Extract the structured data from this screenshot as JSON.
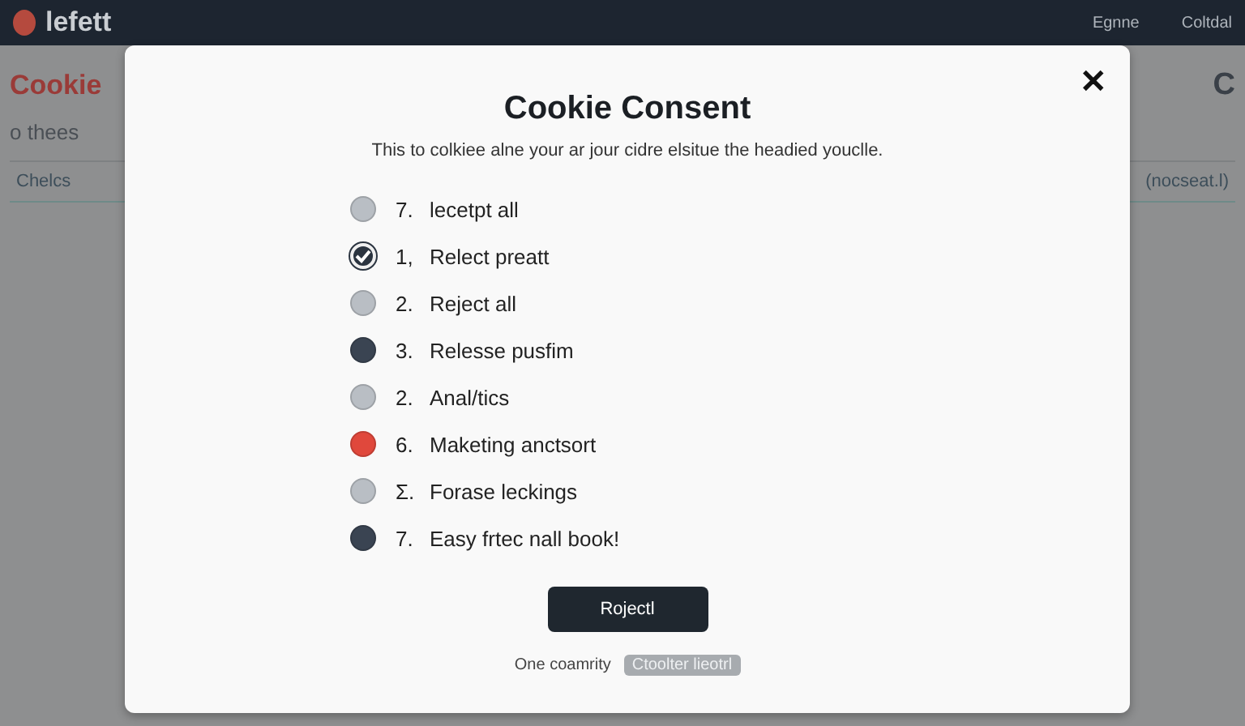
{
  "topbar": {
    "logo": "lefett",
    "links": [
      "Egnne",
      "Coltdal"
    ]
  },
  "background": {
    "heading": "Cookie",
    "intro": "o thees",
    "tab": "Chelcs",
    "tab_right": "(nocseat.l)",
    "right_icon": "C"
  },
  "modal": {
    "title": "Cookie Consent",
    "subtitle": "This to colkiee alne your ar jour cidre elsitue the headied youclle.",
    "options": [
      {
        "number": "7.",
        "label": "lecetpt all",
        "selected": false,
        "color": "#b9bec4"
      },
      {
        "number": "1,",
        "label": "Relect preatt",
        "selected": true,
        "color": "#2b3440"
      },
      {
        "number": "2.",
        "label": "Reject all",
        "selected": false,
        "color": "#b9bec4"
      },
      {
        "number": "3.",
        "label": "Relesse pusfim",
        "selected": false,
        "color": "#3a4452"
      },
      {
        "number": "2.",
        "label": "Anal/tics",
        "selected": false,
        "color": "#b9bec4"
      },
      {
        "number": "6.",
        "label": "Maketing anctsort",
        "selected": false,
        "color": "#e0483c"
      },
      {
        "number": "Σ.",
        "label": "Forase leckings",
        "selected": false,
        "color": "#b9bec4"
      },
      {
        "number": "7.",
        "label": "Easy frtec nall book!",
        "selected": false,
        "color": "#3a4452"
      }
    ],
    "button": "Rojectl",
    "footer_text": "One coamrity",
    "footer_badge": "Ctoolter lieotrl",
    "close": "✕"
  }
}
